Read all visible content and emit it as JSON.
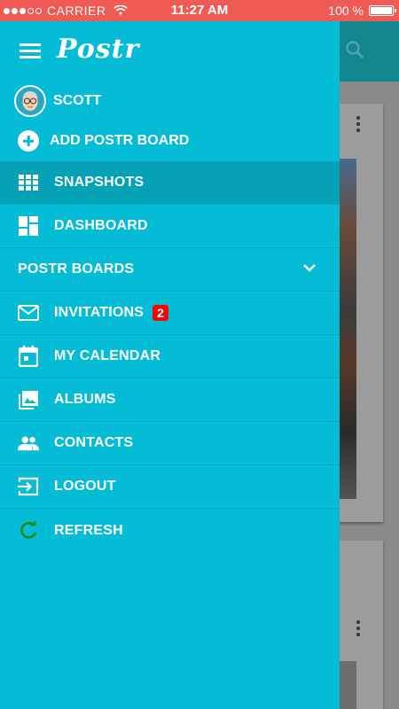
{
  "status_bar": {
    "carrier": "CARRIER",
    "time": "11:27 AM",
    "battery": "100 %"
  },
  "drawer": {
    "logo": "Postr",
    "user_name": "SCOTT",
    "add_board_label": "ADD POSTR BOARD",
    "items": [
      {
        "label": "SNAPSHOTS",
        "icon": "grid-icon"
      },
      {
        "label": "DASHBOARD",
        "icon": "dashboard-icon"
      },
      {
        "label": "POSTR BOARDS",
        "icon": "chevron-down-icon"
      },
      {
        "label": "INVITATIONS",
        "icon": "mail-icon",
        "badge": "2"
      },
      {
        "label": "MY CALENDAR",
        "icon": "calendar-icon"
      },
      {
        "label": "ALBUMS",
        "icon": "photo-album-icon"
      },
      {
        "label": "CONTACTS",
        "icon": "people-icon"
      },
      {
        "label": "LOGOUT",
        "icon": "logout-icon"
      },
      {
        "label": "REFRESH",
        "icon": "refresh-icon"
      }
    ]
  },
  "colors": {
    "status_bar": "#f05a55",
    "drawer": "#04bcd5",
    "active_item": "#05a2b7",
    "badge": "#ff0000",
    "refresh_icon": "#1b8a1b"
  }
}
